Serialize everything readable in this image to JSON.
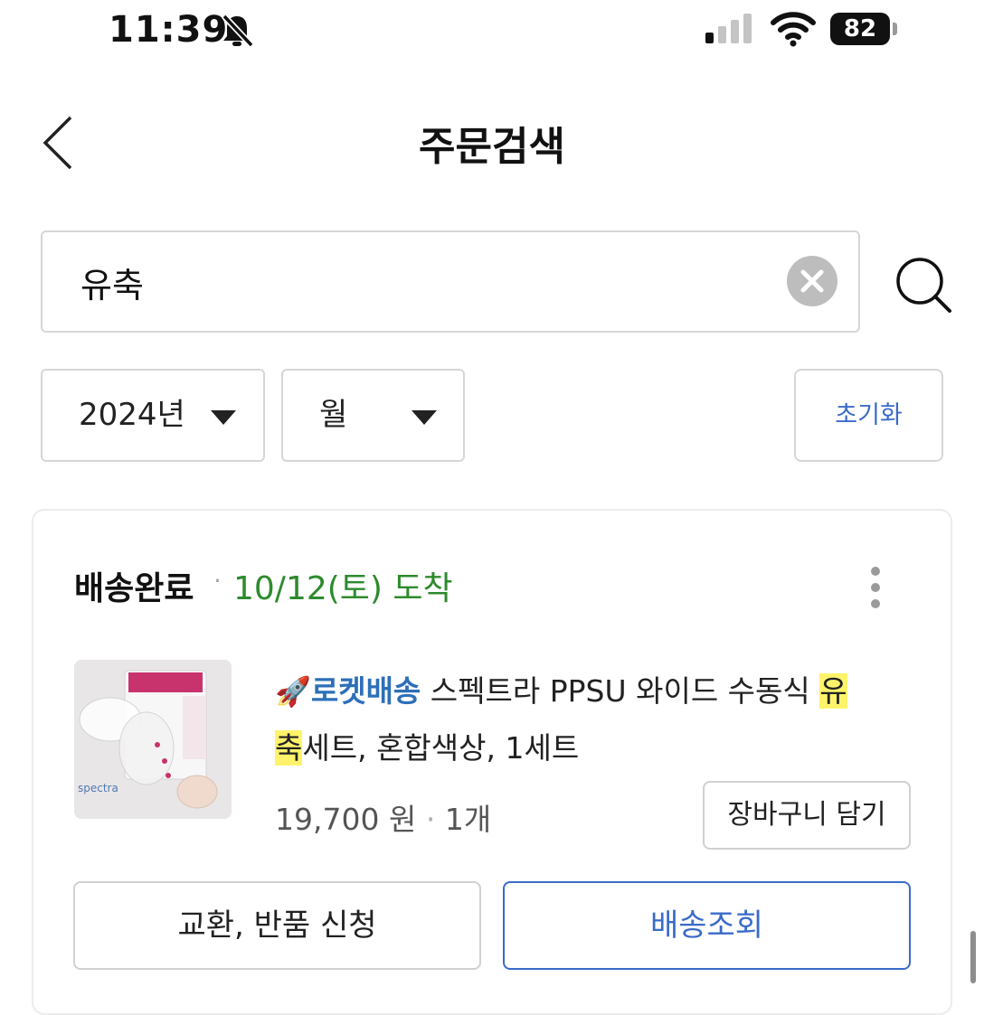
{
  "status_bar": {
    "time": "11:39",
    "battery": "82",
    "icons": [
      "bell-muted-icon",
      "cellular-signal-icon",
      "wifi-icon",
      "battery-icon"
    ]
  },
  "header": {
    "title": "주문검색",
    "back_icon": "chevron-left-icon"
  },
  "search": {
    "value": "유축",
    "clear_icon": "clear-x-icon",
    "search_icon": "magnifier-icon"
  },
  "filters": {
    "year": "2024년",
    "month": "월",
    "reset_label": "초기화"
  },
  "order": {
    "status": "배송완료",
    "separator": "·",
    "arrival": "10/12(토) 도착",
    "more_icon": "more-vertical-icon",
    "product": {
      "badge_icon": "rocket-icon",
      "badge_label": "로켓배송",
      "name_part1": " 스펙트라 PPSU 와이드 수동식 ",
      "name_highlight1": "유",
      "name_highlight2": "축",
      "name_part2": "세트, 혼합색상, 1세트",
      "price": "19,700 원",
      "quantity": "1개",
      "image_brand": "spectra"
    },
    "cart_button": "장바구니 담기",
    "exchange_button": "교환, 반품 신청",
    "tracking_button": "배송조회"
  },
  "colors": {
    "accent_blue": "#3a6bc9",
    "arrival_green": "#2e8a2e",
    "highlight_yellow": "#fff36b",
    "rocket_label_blue": "#2d6fb8"
  }
}
